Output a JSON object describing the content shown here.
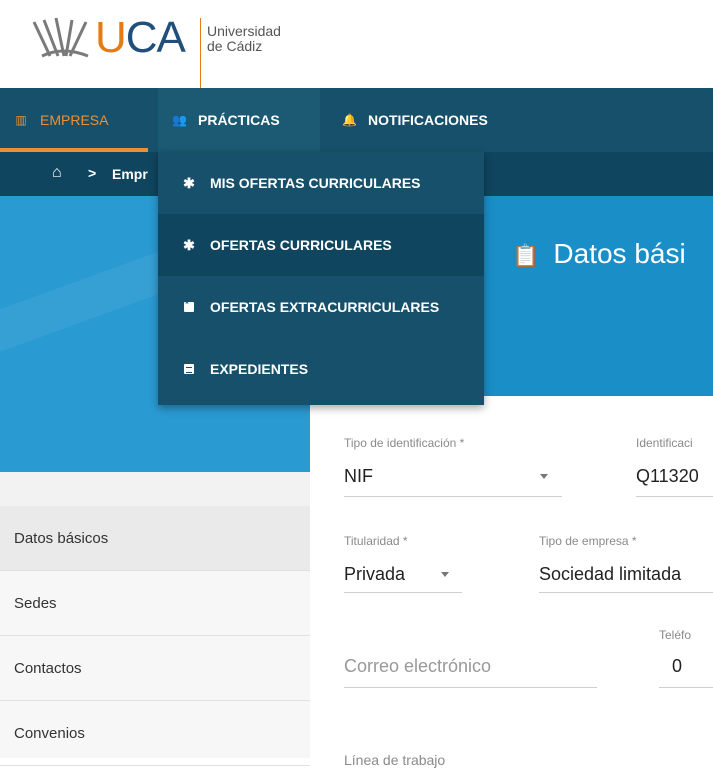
{
  "logo": {
    "brand_u": "U",
    "brand_ca": "CA",
    "line1": "Universidad",
    "line2": "de Cádiz"
  },
  "nav": {
    "empresa": "EMPRESA",
    "practicas": "PRÁCTICAS",
    "notificaciones": "NOTIFICACIONES"
  },
  "breadcrumb": {
    "separator": ">",
    "crumb": "Empr"
  },
  "dropdown": {
    "items": [
      {
        "label": "MIS OFERTAS CURRICULARES",
        "icon": "asterisk-icon"
      },
      {
        "label": "OFERTAS CURRICULARES",
        "icon": "asterisk-icon"
      },
      {
        "label": "OFERTAS EXTRACURRICULARES",
        "icon": "square-asterisk-icon"
      },
      {
        "label": "EXPEDIENTES",
        "icon": "document-icon"
      }
    ]
  },
  "hero": {
    "title": "Datos bási"
  },
  "sidebar": {
    "items": [
      {
        "label": "Datos básicos"
      },
      {
        "label": "Sedes"
      },
      {
        "label": "Contactos"
      },
      {
        "label": "Convenios"
      }
    ]
  },
  "form": {
    "tipo_id_label": "Tipo de identificación *",
    "tipo_id_value": "NIF",
    "identificacion_label": "Identificaci",
    "identificacion_value": "Q11320",
    "titularidad_label": "Titularidad *",
    "titularidad_value": "Privada",
    "tipo_empresa_label": "Tipo de empresa *",
    "tipo_empresa_value": "Sociedad limitada",
    "correo_placeholder": "Correo electrónico",
    "telefono_label": "Teléfo",
    "telefono_value": "0",
    "linea_label": "Línea de trabajo"
  }
}
